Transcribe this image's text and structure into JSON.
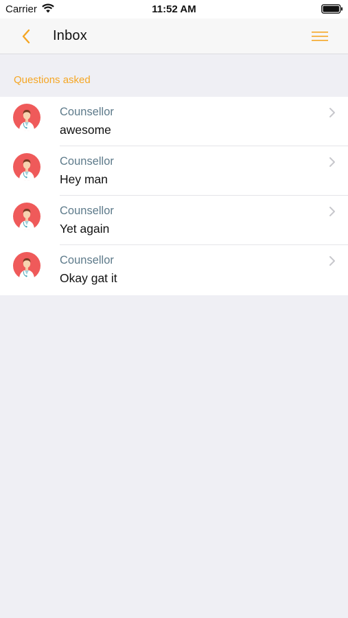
{
  "status_bar": {
    "carrier": "Carrier",
    "time": "11:52 AM"
  },
  "nav": {
    "title": "Inbox",
    "back_icon": "chevron-left-icon",
    "menu_icon": "hamburger-menu-icon",
    "accent_color": "#f5a623"
  },
  "section": {
    "header": "Questions asked"
  },
  "messages": [
    {
      "sender": "Counsellor",
      "text": "awesome"
    },
    {
      "sender": "Counsellor",
      "text": "Hey man"
    },
    {
      "sender": "Counsellor",
      "text": "Yet again"
    },
    {
      "sender": "Counsellor",
      "text": "Okay gat it"
    }
  ],
  "colors": {
    "sender": "#5d7a8a",
    "avatar_bg": "#ef5a5a",
    "background": "#efeff4"
  }
}
